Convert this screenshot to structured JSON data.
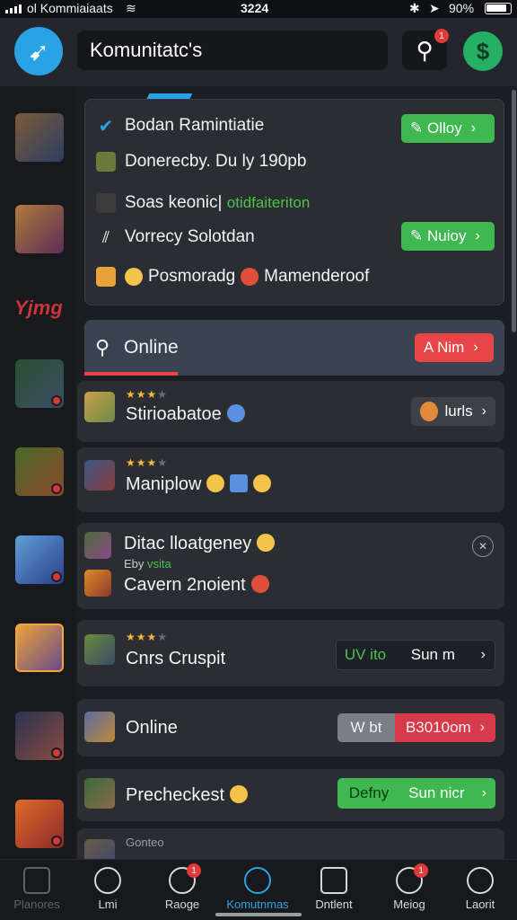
{
  "status_bar": {
    "carrier": "ol Kommiaiaats",
    "time": "3224",
    "battery": "90%"
  },
  "header": {
    "title": "Komunitatc's",
    "search_badge": "1",
    "brand_color": "#2aa3e6",
    "coin_color": "#25b066"
  },
  "sidebar": {
    "logo_text": "Yjmg"
  },
  "top_card": {
    "rows": [
      {
        "text": "Bodan Ramintiatie",
        "button": "Olloy"
      },
      {
        "text": "Donerecby. Du ly 190pb"
      },
      {
        "text": "Soas keonic|",
        "accent": "otidfaiteriton"
      },
      {
        "text": "Vorrecy Solotdan",
        "button": "Nuioy"
      },
      {
        "text": "Posmoradg",
        "text2": "Mamenderoof"
      }
    ]
  },
  "online_header": {
    "title": "Online",
    "button": "A Nim"
  },
  "items": [
    {
      "title": "Stirioabatoe",
      "button": "lurls"
    },
    {
      "title": "Maniplow"
    },
    {
      "title": "Ditac lloatgeney",
      "sub": "Eby",
      "sub_accent": "vsita",
      "title2": "Cavern 2noient"
    },
    {
      "title": "Cnrs Cruspit",
      "left_btn": "UV ito",
      "right_btn": "Sun m"
    },
    {
      "title": "Online",
      "left_btn": "W bt",
      "right_btn": "B3010om"
    },
    {
      "title": "Precheckest",
      "left_btn": "Defny",
      "right_btn": "Sun nicr"
    },
    {
      "title": "Gonteo"
    }
  ],
  "bottom_nav": [
    {
      "label": "Planores",
      "badge": ""
    },
    {
      "label": "Lmi",
      "badge": ""
    },
    {
      "label": "Raoge",
      "badge": "1"
    },
    {
      "label": "Komutnmas",
      "badge": ""
    },
    {
      "label": "Dntlent",
      "badge": ""
    },
    {
      "label": "Meiog",
      "badge": "1"
    },
    {
      "label": "Laorit",
      "badge": ""
    }
  ]
}
